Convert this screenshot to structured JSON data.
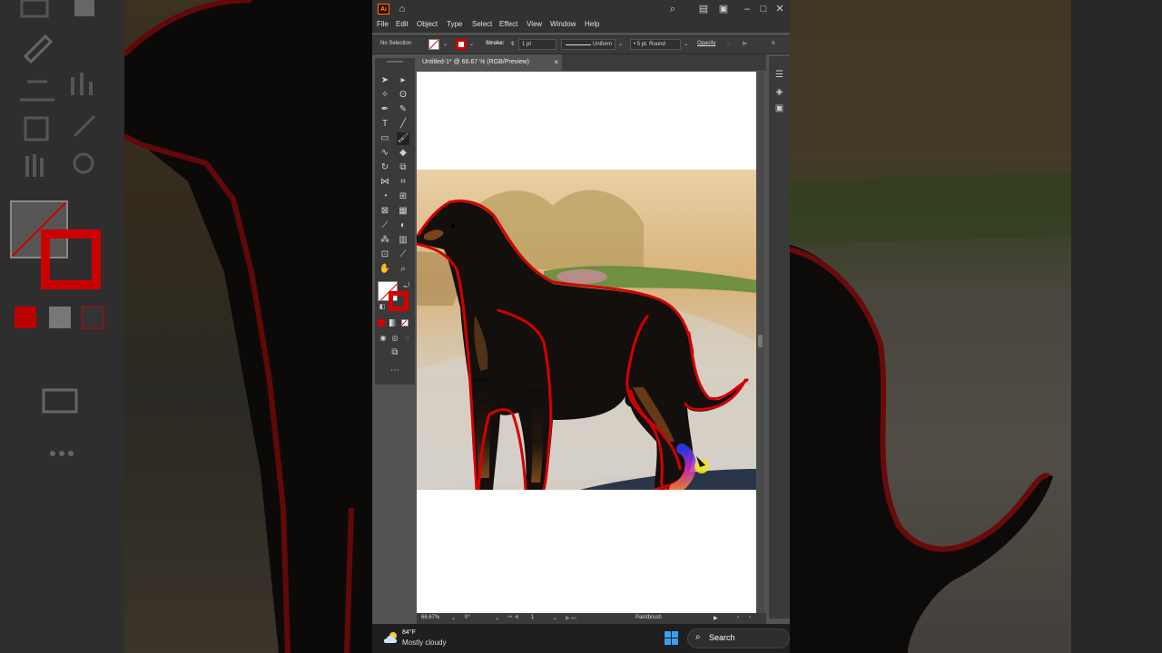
{
  "app": {
    "logo_text": "Ai",
    "menu": [
      "File",
      "Edit",
      "Object",
      "Type",
      "Select",
      "Effect",
      "View",
      "Window",
      "Help"
    ],
    "window_controls": {
      "minimize": "–",
      "maximize": "□",
      "close": "✕"
    }
  },
  "control_bar": {
    "selection": "No Selection",
    "stroke_label": "Stroke:",
    "stroke_weight": "1 pt",
    "profile": "Uniform",
    "brush": "5 pt. Round",
    "opacity_label": "Opacity"
  },
  "document": {
    "tab_title": "Untitled-1* @ 66.67 % (RGB/Preview)",
    "tab_close": "×"
  },
  "status_bar": {
    "zoom": "66.67%",
    "rotation": "0°",
    "artboard": "1",
    "tool": "Paintbrush"
  },
  "taskbar": {
    "temperature": "84°F",
    "condition": "Mostly cloudy",
    "search_label": "Search"
  },
  "colors": {
    "stroke": "#d40000",
    "ui_dark": "#323232",
    "accent": "#ff9a00"
  }
}
